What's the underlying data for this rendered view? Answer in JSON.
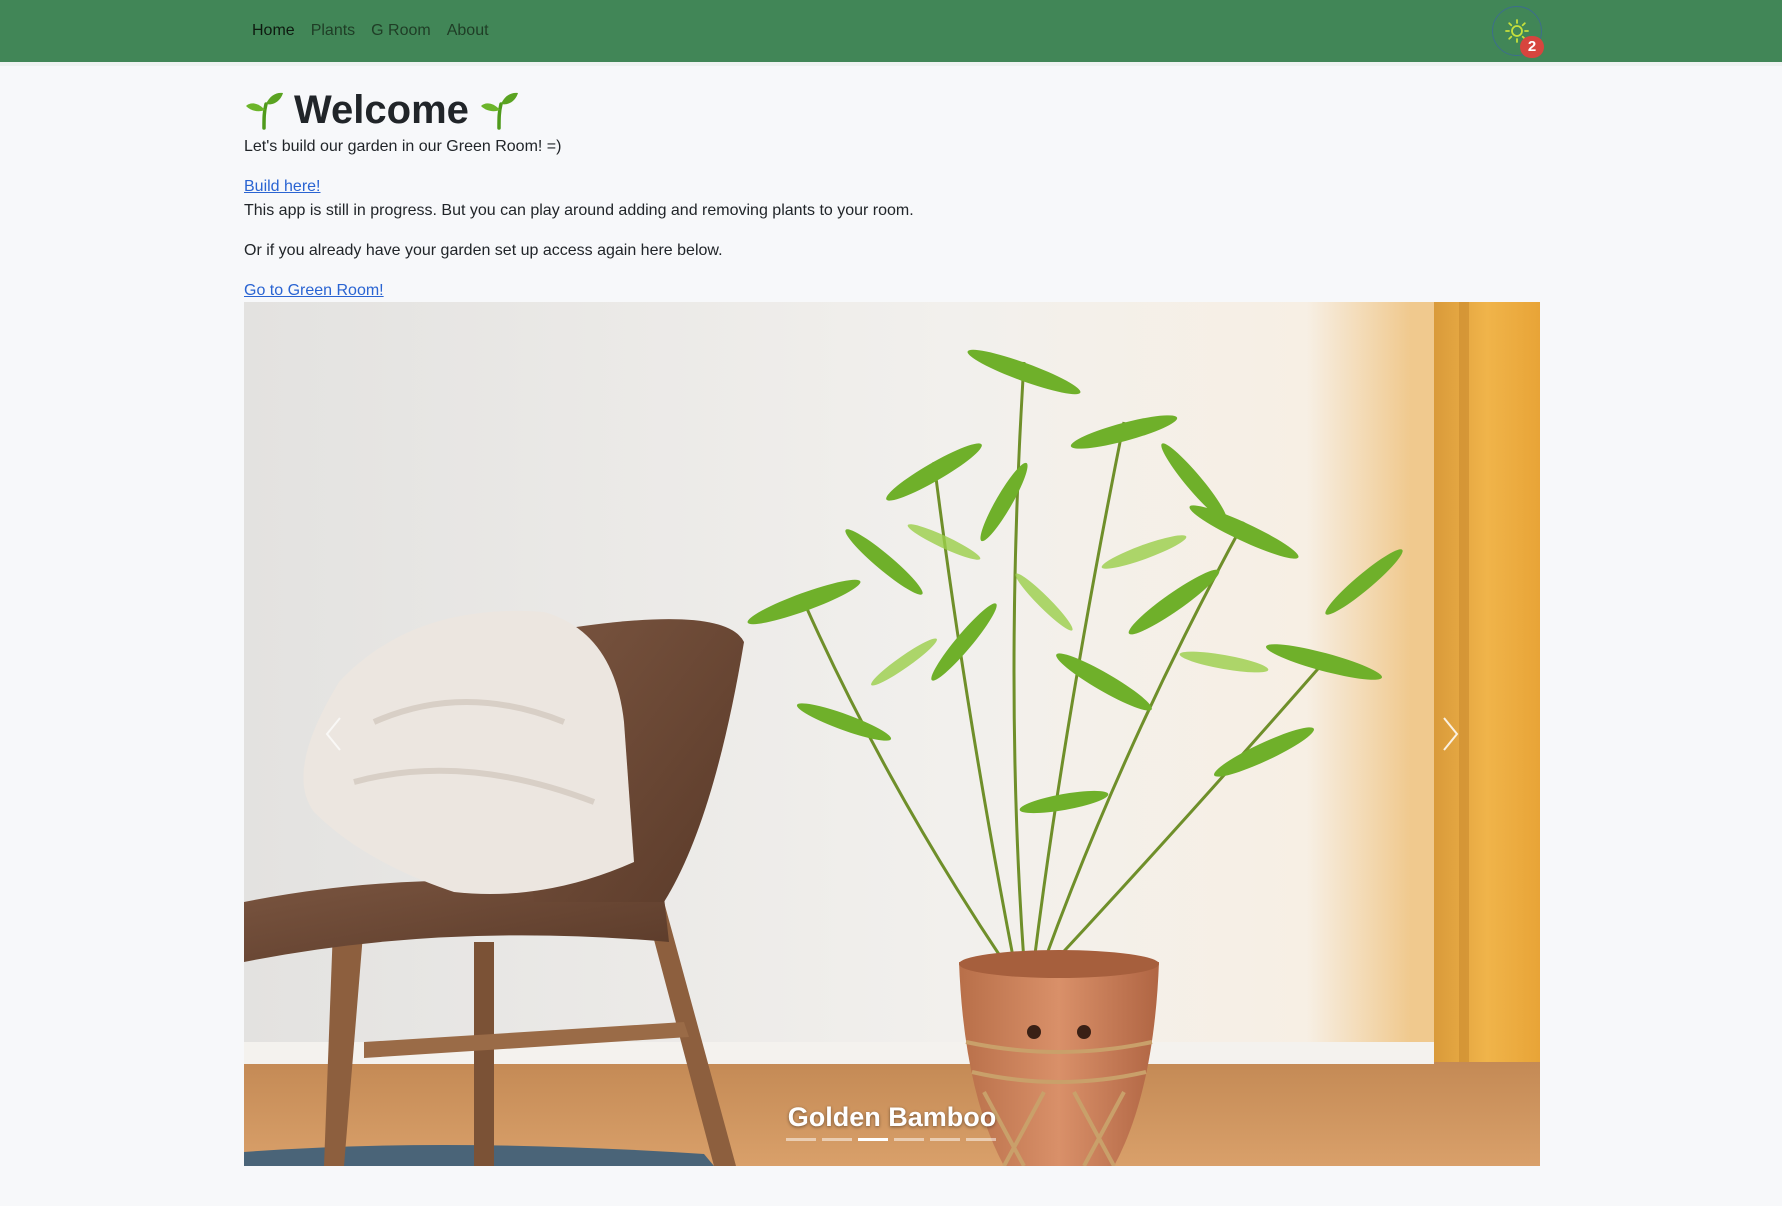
{
  "nav": {
    "links": [
      {
        "label": "Home",
        "active": true
      },
      {
        "label": "Plants",
        "active": false
      },
      {
        "label": "G Room",
        "active": false
      },
      {
        "label": "About",
        "active": false
      }
    ],
    "theme_icon": "sun-icon",
    "badge_count": "2",
    "brand_color": "#418657",
    "badge_color": "#d7453e"
  },
  "main": {
    "title": "Welcome",
    "title_icon": "sprout-icon",
    "intro": "Let's build our garden in our Green Room! =)",
    "build_link": "Build here!",
    "progress_note": "This app is still in progress. But you can play around adding and removing plants to your room.",
    "returning_note": "Or if you already have your garden set up access again here below.",
    "room_link": "Go to Green Room!",
    "link_color": "#2a64d2"
  },
  "carousel": {
    "caption": "Golden Bamboo",
    "slide_count": 6,
    "active_index": 2,
    "prev_icon": "chevron-left-icon",
    "next_icon": "chevron-right-icon"
  }
}
